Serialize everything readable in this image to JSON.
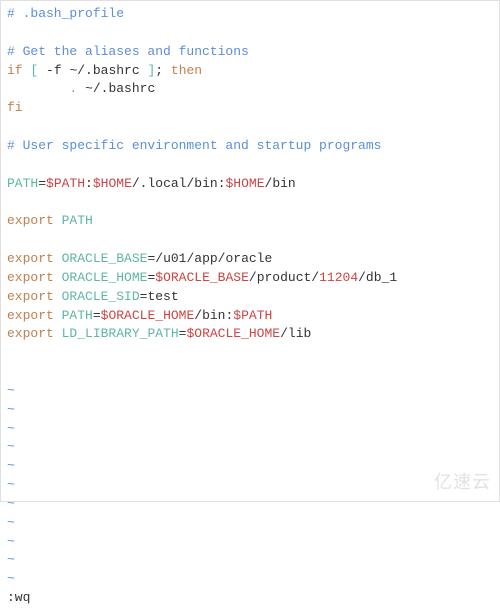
{
  "comments": {
    "header": "# .bash_profile",
    "aliases": "# Get the aliases and functions",
    "userspec": "# User specific environment and startup programs"
  },
  "keywords": {
    "if": "if",
    "then": "then",
    "fi": "fi",
    "export": "export"
  },
  "builtins": {
    "source": ".",
    "test_open": "[",
    "test_close": "]"
  },
  "vars": {
    "path": "$PATH",
    "home": "$HOME",
    "oracle_base": "$ORACLE_BASE",
    "oracle_home": "$ORACLE_HOME"
  },
  "names": {
    "path": "PATH",
    "oracle_base": "ORACLE_BASE",
    "oracle_home": "ORACLE_HOME",
    "oracle_sid": "ORACLE_SID",
    "ld_library_path": "LD_LIBRARY_PATH"
  },
  "text": {
    "flag_f": " -f",
    "bashrc_path": " ~/.bashrc ",
    "semi_space": "; ",
    "indent_source": "        ",
    "space": " ",
    "src_bashrc": "~/.bashrc",
    "eq": "=",
    "colon": ":",
    "path_local": "/.local/bin:",
    "path_bin": "/bin",
    "ob_val": "/u01/app/oracle",
    "oh_mid": "/product/",
    "oh_ver": "11204",
    "oh_tail": "/db_1",
    "sid_val": "test",
    "new_path_mid": "/bin:",
    "ld_tail": "/lib",
    "tilde": "~",
    "wq": ":wq"
  },
  "watermark": "亿速云"
}
